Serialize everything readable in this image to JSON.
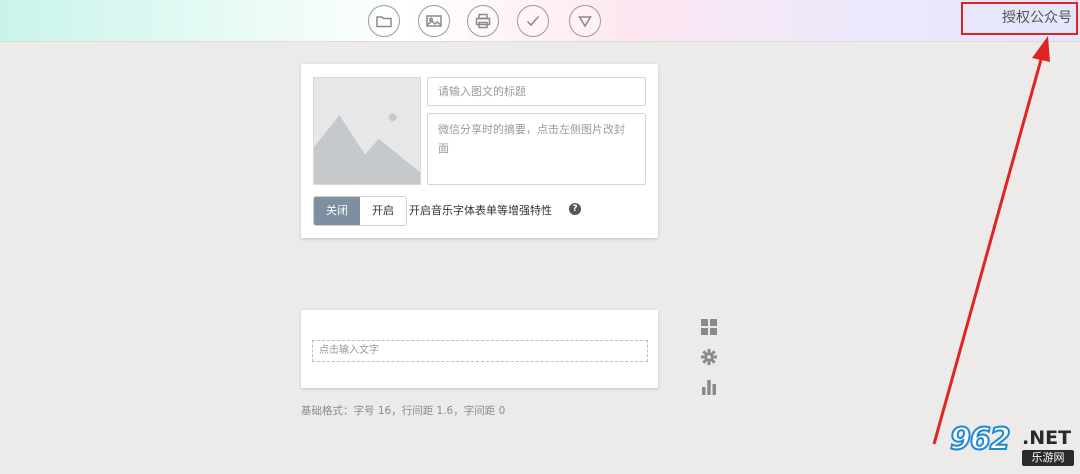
{
  "toolbar": {
    "buttons": [
      {
        "icon": "folder-icon"
      },
      {
        "icon": "image-icon"
      },
      {
        "icon": "printer-icon"
      },
      {
        "icon": "check-icon"
      },
      {
        "icon": "triangle-down-icon"
      }
    ],
    "auth_label": "授权公众号",
    "auth_border_color": "#e02424"
  },
  "article_card": {
    "title_placeholder": "请输入图文的标题",
    "summary_placeholder": "微信分享时的摘要，点击左侧图片改封面",
    "toggle_off": "关闭",
    "toggle_on": "开启",
    "feature_text": "开启音乐字体表单等增强特性",
    "help_icon_glyph": "?"
  },
  "editor_card": {
    "text_placeholder": "点击输入文字"
  },
  "format_text": "基础格式：字号 16，行间距 1.6，字间距 0",
  "side_icons": [
    "grid-icon",
    "gear-icon",
    "bar-chart-icon"
  ],
  "watermark": {
    "number": "962",
    "suffix": ".NET",
    "sub": "乐游网"
  },
  "colors": {
    "accent_toggle": "#7d8fa0",
    "annotation": "#e02424",
    "background": "#ecebe9"
  }
}
